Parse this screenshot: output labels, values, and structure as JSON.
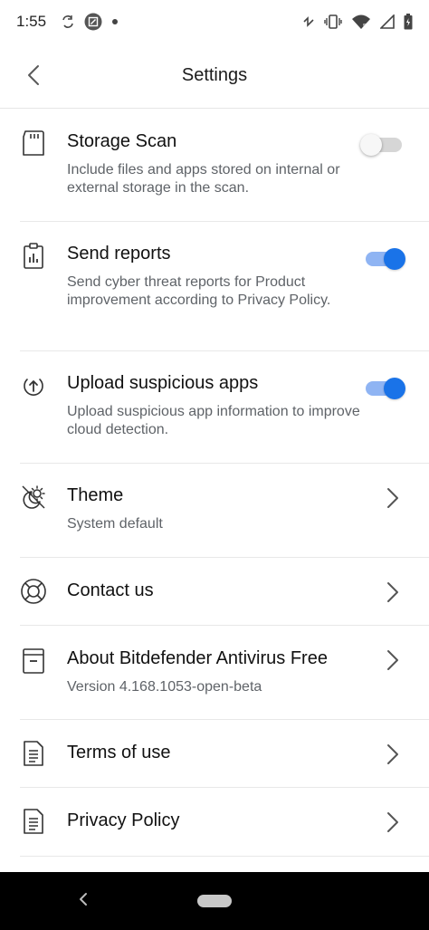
{
  "status_bar": {
    "time": "1:55",
    "left_icons": [
      "sync-icon",
      "screenshot-icon",
      "dot-icon"
    ],
    "right_icons": [
      "nfc-icon",
      "vibrate-icon",
      "wifi-icon",
      "signal-icon",
      "battery-icon"
    ]
  },
  "app_bar": {
    "title": "Settings",
    "back_icon": "chevron-left-icon"
  },
  "settings": [
    {
      "id": "storage-scan",
      "icon": "sd-card-icon",
      "title": "Storage Scan",
      "description": "Include files and apps stored on internal or external storage in the scan.",
      "control": "toggle",
      "enabled": false
    },
    {
      "id": "send-reports",
      "icon": "clipboard-chart-icon",
      "title": "Send reports",
      "description": "Send cyber threat reports for Product improvement according to Privacy Policy.",
      "control": "toggle",
      "enabled": true
    },
    {
      "id": "upload-suspicious-apps",
      "icon": "upload-circle-icon",
      "title": "Upload suspicious apps",
      "description": "Upload suspicious app information to improve cloud detection.",
      "control": "toggle",
      "enabled": true
    },
    {
      "id": "theme",
      "icon": "theme-icon",
      "title": "Theme",
      "description": "System default",
      "control": "chevron"
    },
    {
      "id": "contact-us",
      "icon": "lifebuoy-icon",
      "title": "Contact us",
      "description": "",
      "control": "chevron"
    },
    {
      "id": "about",
      "icon": "about-box-icon",
      "title": "About Bitdefender Antivirus Free",
      "description": "Version 4.168.1053-open-beta",
      "control": "chevron"
    },
    {
      "id": "terms-of-use",
      "icon": "document-icon",
      "title": "Terms of use",
      "description": "",
      "control": "chevron"
    },
    {
      "id": "privacy-policy",
      "icon": "document-icon",
      "title": "Privacy Policy",
      "description": "",
      "control": "chevron"
    }
  ],
  "colors": {
    "accent": "#1a73e8",
    "accent_track": "#8fb4f3",
    "text_primary": "#111111",
    "text_secondary": "#5f6368",
    "divider": "#e8e8e8",
    "nav_bar": "#000000"
  },
  "nav_bar": {
    "back_icon": "nav-back-icon",
    "home_icon": "home-pill-icon"
  }
}
